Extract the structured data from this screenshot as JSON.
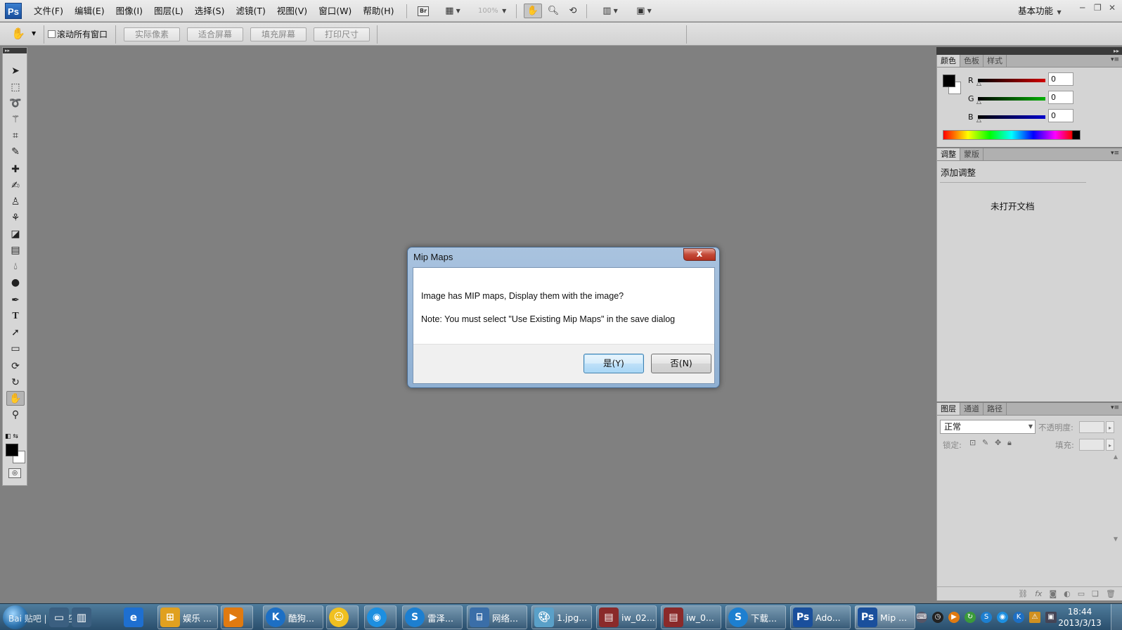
{
  "app": {
    "logo_text": "Ps",
    "menus": [
      "文件(F)",
      "编辑(E)",
      "图像(I)",
      "图层(L)",
      "选择(S)",
      "滤镜(T)",
      "视图(V)",
      "窗口(W)",
      "帮助(H)"
    ],
    "bridge_label": "Br",
    "zoom": "100%",
    "workspace": "基本功能"
  },
  "options_bar": {
    "scroll_all_label": "滚动所有窗口",
    "buttons": [
      "实际像素",
      "适合屏幕",
      "填充屏幕",
      "打印尺寸"
    ]
  },
  "color_panel": {
    "tabs": [
      "颜色",
      "色板",
      "样式"
    ],
    "channels": [
      {
        "label": "R",
        "value": "0",
        "color": "#d00000"
      },
      {
        "label": "G",
        "value": "0",
        "color": "#00b000"
      },
      {
        "label": "B",
        "value": "0",
        "color": "#0000cc"
      }
    ]
  },
  "adjust_panel": {
    "tabs": [
      "调整",
      "蒙版"
    ],
    "title": "添加调整",
    "empty": "未打开文档"
  },
  "layers_panel": {
    "tabs": [
      "图层",
      "通道",
      "路径"
    ],
    "blend_mode": "正常",
    "opacity_label": "不透明度:",
    "lock_label": "锁定:",
    "fill_label": "填充:"
  },
  "dialog": {
    "title": "Mip Maps",
    "close": "x",
    "message": "Image has MIP maps, Display them with the image?",
    "note": "Note: You must select \"Use Existing Mip Maps\" in the save dialog",
    "yes": "是(Y)",
    "no": "否(N)"
  },
  "taskbar": {
    "watermark": "Bai 贴吧 | 使命召唤吧",
    "tasks": [
      {
        "label": "娱乐 ...",
        "icon": "windows-icon",
        "color": "#e0a020"
      },
      {
        "label": "",
        "icon": "media-player-icon",
        "color": "#e07a10"
      },
      {
        "label": "酷狗...",
        "icon": "kugou-icon",
        "color": "#1d6fc4"
      },
      {
        "label": "",
        "icon": "qq-icon",
        "color": "#f0c020"
      },
      {
        "label": "",
        "icon": "location-icon",
        "color": "#1d8fe0"
      },
      {
        "label": "雷泽...",
        "icon": "sogou-icon",
        "color": "#1d7fd0"
      },
      {
        "label": "网络...",
        "icon": "network-icon",
        "color": "#3a6ea8"
      },
      {
        "label": "1.jpg...",
        "icon": "paint-icon",
        "color": "#5aa0c8"
      },
      {
        "label": "iw_02...",
        "icon": "winrar-icon",
        "color": "#8a2a2a"
      },
      {
        "label": "iw_0...",
        "icon": "winrar-icon",
        "color": "#8a2a2a"
      },
      {
        "label": "下载...",
        "icon": "sogou-icon",
        "color": "#1d7fd0"
      },
      {
        "label": "Ado...",
        "icon": "photoshop-icon",
        "color": "#1a4f9c"
      },
      {
        "label": "Mip ...",
        "icon": "photoshop-icon",
        "color": "#1a4f9c"
      }
    ],
    "time": "18:44",
    "date": "2013/3/13"
  }
}
